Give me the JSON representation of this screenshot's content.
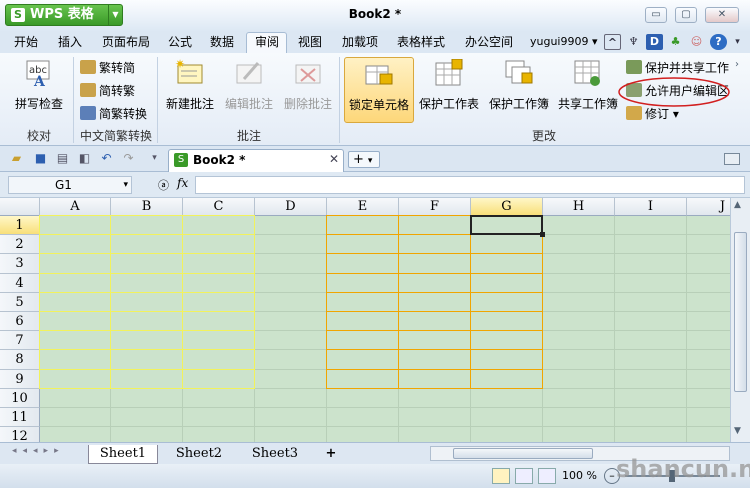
{
  "app": {
    "brand": "WPS 表格",
    "document_title": "Book2 *"
  },
  "window_controls": {
    "minimize": "▭",
    "restore": "▢",
    "close": "✕"
  },
  "menu": [
    "开始",
    "插入",
    "页面布局",
    "公式",
    "数据",
    "审阅",
    "视图",
    "加载项",
    "表格样式",
    "办公空间"
  ],
  "active_menu": "审阅",
  "user": "yugui9909",
  "ribbon": {
    "proofing": {
      "label": "校对",
      "spell_check": "拼写检查"
    },
    "chinese": {
      "label": "中文简繁转换",
      "trad_to_simp": "繁转简",
      "simp_to_trad": "简转繁",
      "convert": "简繁转换"
    },
    "comments": {
      "label": "批注",
      "new": "新建批注",
      "edit": "编辑批注",
      "delete": "删除批注"
    },
    "changes": {
      "label": "更改",
      "lock_cell": "锁定单元格",
      "protect_sheet": "保护工作表",
      "protect_book": "保护工作簿",
      "share_book": "共享工作簿",
      "protect_share": "保护并共享工作",
      "allow_edit": "允许用户编辑区",
      "revise": "修订"
    }
  },
  "doc_tab": {
    "title": "Book2 *"
  },
  "formula": {
    "name_box": "G1",
    "fx": "fx"
  },
  "grid": {
    "columns": [
      "A",
      "B",
      "C",
      "D",
      "E",
      "F",
      "G",
      "H",
      "I",
      "J"
    ],
    "rows": [
      "1",
      "2",
      "3",
      "4",
      "5",
      "6",
      "7",
      "8",
      "9",
      "10",
      "11",
      "12"
    ],
    "selected": "G1"
  },
  "sheets": [
    "Sheet1",
    "Sheet2",
    "Sheet3"
  ],
  "status": {
    "zoom": "100 %"
  },
  "watermark": "shancun.net",
  "colors": {
    "grid_bg": "#cce3cc",
    "yellow_border": "#f2f25c",
    "orange_border": "#f0a500",
    "accent_green": "#3a9a28"
  }
}
